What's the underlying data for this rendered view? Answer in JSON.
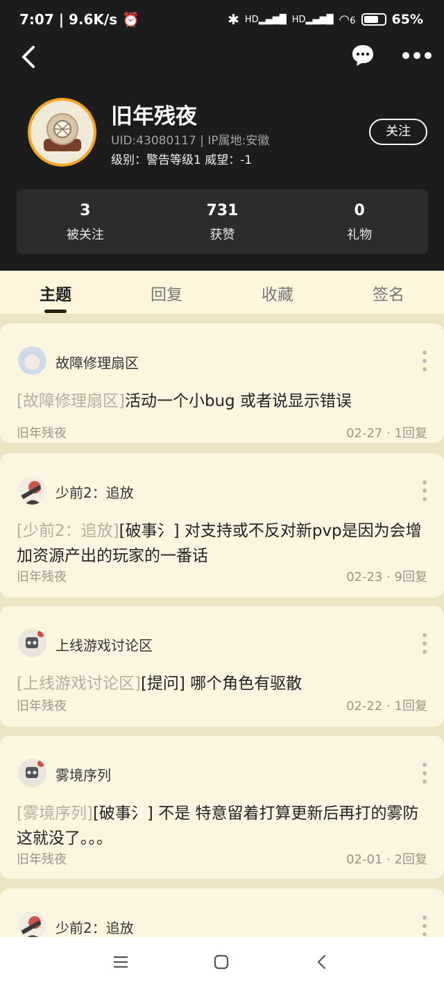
{
  "status": {
    "time": "7:07",
    "speed": "9.6K/s",
    "battery": "65%",
    "hd1": "HD",
    "hd2": "HD",
    "wifi6": "6"
  },
  "profile": {
    "name": "旧年残夜",
    "uid_line": "UID:43080117 | IP属地:安徽",
    "level_line": "级别：警告等级1  威望：-1",
    "follow_label": "关注"
  },
  "stats": [
    {
      "num": "3",
      "label": "被关注"
    },
    {
      "num": "731",
      "label": "获赞"
    },
    {
      "num": "0",
      "label": "礼物"
    }
  ],
  "tabs": [
    "主题",
    "回复",
    "收藏",
    "签名"
  ],
  "posts": [
    {
      "forum": "故障修理扇区",
      "tag": "[故障修理扇区]",
      "title": "活动一个小bug 或者说显示错误",
      "author": "旧年残夜",
      "date": "02-27",
      "replies": "1回复"
    },
    {
      "forum": "少前2：追放",
      "tag": "[少前2：追放]",
      "title": "[破事氵] 对支持或不反对新pvp是因为会增加资源产出的玩家的一番话",
      "author": "旧年残夜",
      "date": "02-23",
      "replies": "9回复"
    },
    {
      "forum": "上线游戏讨论区",
      "tag": "[上线游戏讨论区]",
      "title": "[提问] 哪个角色有驱散",
      "author": "旧年残夜",
      "date": "02-22",
      "replies": "1回复"
    },
    {
      "forum": "雾境序列",
      "tag": "[雾境序列]",
      "title": "[破事氵] 不是 特意留着打算更新后再打的雾防这就没了。。。",
      "author": "旧年残夜",
      "date": "02-01",
      "replies": "2回复"
    },
    {
      "forum": "少前2：追放"
    }
  ],
  "colors": {
    "header_bg": "#1c1c1c",
    "page_bg": "#fcf6e0",
    "avatar_ring": "#f7a622"
  }
}
